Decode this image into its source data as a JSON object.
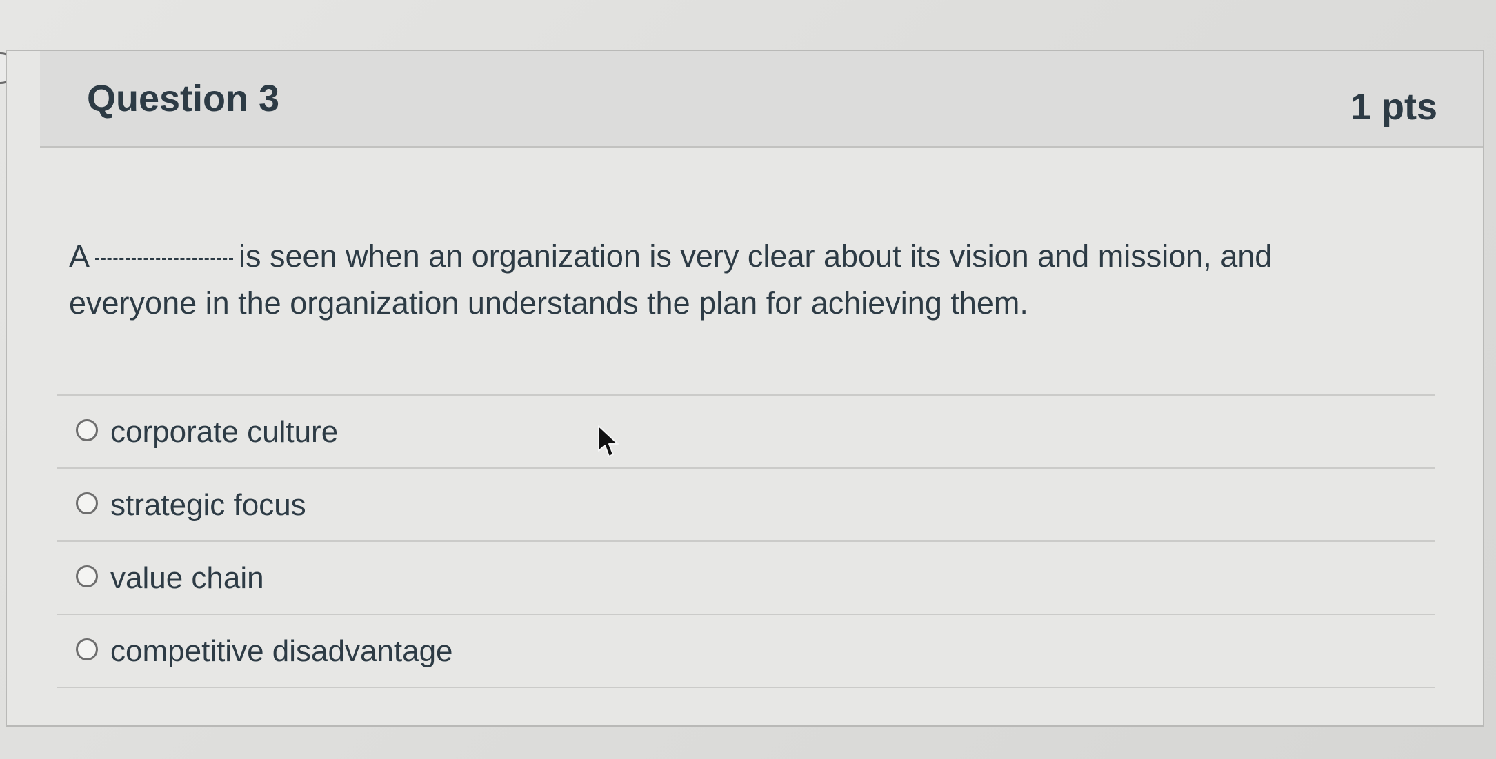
{
  "question": {
    "title": "Question 3",
    "points": "1 pts",
    "text_before": "A",
    "text_after": "is seen when an organization is very clear about its vision and mission, and everyone in the organization understands the plan for achieving them."
  },
  "answers": [
    {
      "label": "corporate culture"
    },
    {
      "label": "strategic focus"
    },
    {
      "label": "value chain"
    },
    {
      "label": "competitive disadvantage"
    }
  ],
  "icons": {
    "toggle": "chevron-right-icon",
    "cursor": "mouse-pointer-icon"
  }
}
